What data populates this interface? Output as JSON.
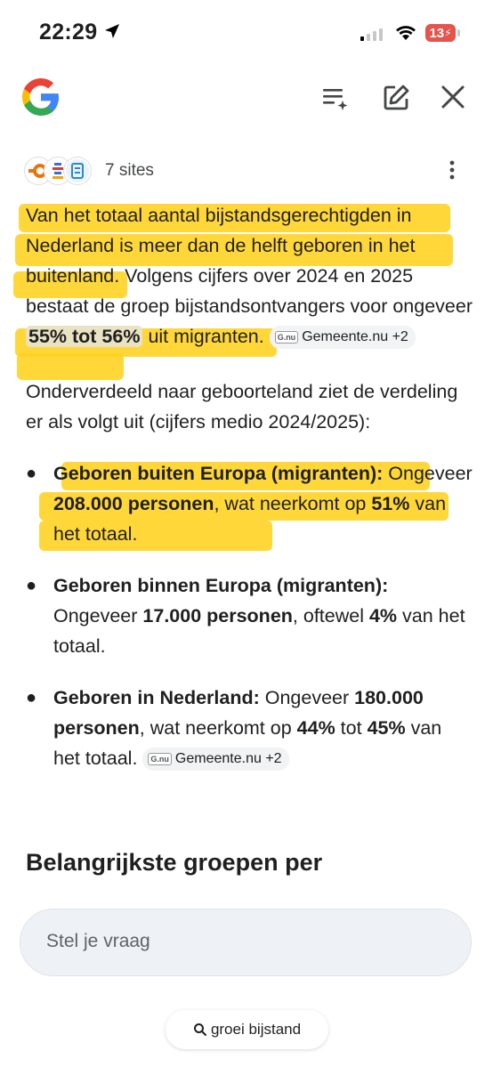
{
  "status_bar": {
    "time": "22:29",
    "battery": "13"
  },
  "header": {
    "logo": "google-g-icon"
  },
  "sources": {
    "count_label": "7 sites"
  },
  "answer": {
    "p1_text": "Van het totaal aantal bijstandsgerechtigden in Nederland is meer dan de helft geboren in het buitenland. Volgens cijfers over 2024 en 2025 bestaat de groep bijstandsontvangers voor ongeveer ",
    "p1_pct": "55% tot 56%",
    "p1_after": " uit migranten.",
    "p1_chip": "Gemeente.nu +2",
    "p2_text": "Onderverdeeld naar geboorteland ziet de verdeling er als volgt uit (cijfers medio 2024/2025):",
    "items": [
      {
        "title": "Geboren buiten Europa (migranten):",
        "t1": " Ongeveer ",
        "b1": "208.000 personen",
        "t2": ", wat neerkomt op ",
        "b2": "51%",
        "t3": " van het totaal."
      },
      {
        "title": "Geboren binnen Europa (migranten):",
        "t1": " Ongeveer ",
        "b1": "17.000 personen",
        "t2": ", oftewel ",
        "b2": "4%",
        "t3": " van het totaal."
      },
      {
        "title": "Geboren in Nederland:",
        "t1": " Ongeveer ",
        "b1": "180.000 personen",
        "t2": ", wat neerkomt op ",
        "b2": "44%",
        "t3": " tot ",
        "b3": "45%",
        "t4": " van het totaal.",
        "chip": "Gemeente.nu +2"
      }
    ],
    "section_heading": "Belangrijkste groepen per"
  },
  "chip_logo": "G.nu",
  "ask": {
    "placeholder": "Stel je vraag"
  },
  "suggestion": {
    "label": "groei bijstand"
  },
  "colors": {
    "highlight": "#ffd21e",
    "google_blue": "#4285f4",
    "google_red": "#ea4335",
    "google_yellow": "#fbbc05",
    "google_green": "#34a853"
  }
}
